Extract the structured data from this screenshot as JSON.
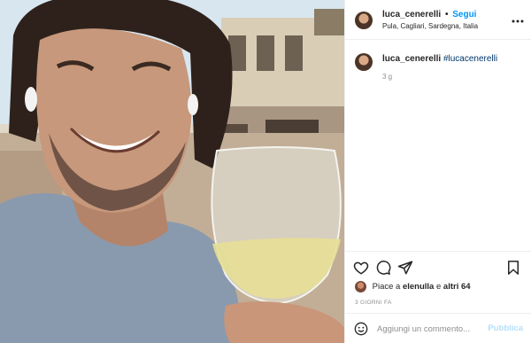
{
  "post": {
    "username": "luca_cenerelli",
    "separator": "•",
    "follow_label": "Segui",
    "location": "Pula, Cagliari, Sardegna, Italia",
    "more_icon": "more-options-icon"
  },
  "caption": {
    "username": "luca_cenerelli",
    "hashtag": "#lucacenerelli",
    "time_ago": "3 g"
  },
  "actions": {
    "icons": [
      "heart-icon",
      "comment-icon",
      "share-icon",
      "bookmark-icon"
    ],
    "likes_prefix": "Piace a",
    "liker": "elenulla",
    "likes_and": "e",
    "likes_others": "altri 64",
    "date": "3 GIORNI FA"
  },
  "comment": {
    "placeholder": "Aggiungi un commento...",
    "publish_label": "Pubblica"
  },
  "colors": {
    "accent": "#0095f6",
    "hashtag": "#00376b",
    "publish_disabled": "#b2dffc",
    "muted": "#8e8e8e"
  }
}
